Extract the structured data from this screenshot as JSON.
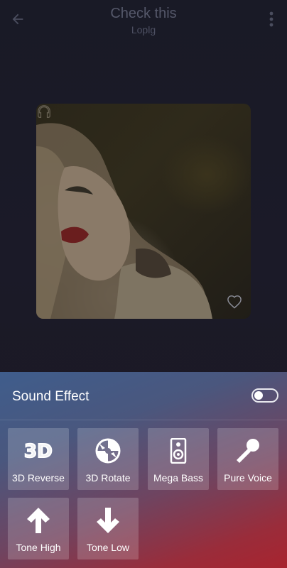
{
  "header": {
    "title": "Check this",
    "artist": "Loplg",
    "back_icon": "arrow-left-icon",
    "menu_icon": "more-vert-icon"
  },
  "album": {
    "favorite_icon": "heart-outline-icon"
  },
  "sound_effect": {
    "title": "Sound Effect",
    "enabled": false,
    "effects": [
      {
        "label": "3D Reverse",
        "icon": "3d-icon"
      },
      {
        "label": "3D Rotate",
        "icon": "rotate-icon"
      },
      {
        "label": "Mega Bass",
        "icon": "speaker-icon"
      },
      {
        "label": "Pure Voice",
        "icon": "microphone-icon"
      },
      {
        "label": "Tone High",
        "icon": "arrow-up-icon"
      },
      {
        "label": "Tone Low",
        "icon": "arrow-down-icon"
      }
    ]
  },
  "colors": {
    "panel_top": "#3f5d8c",
    "panel_bottom": "#a8242f",
    "tile": "rgba(255,255,255,0.18)"
  }
}
